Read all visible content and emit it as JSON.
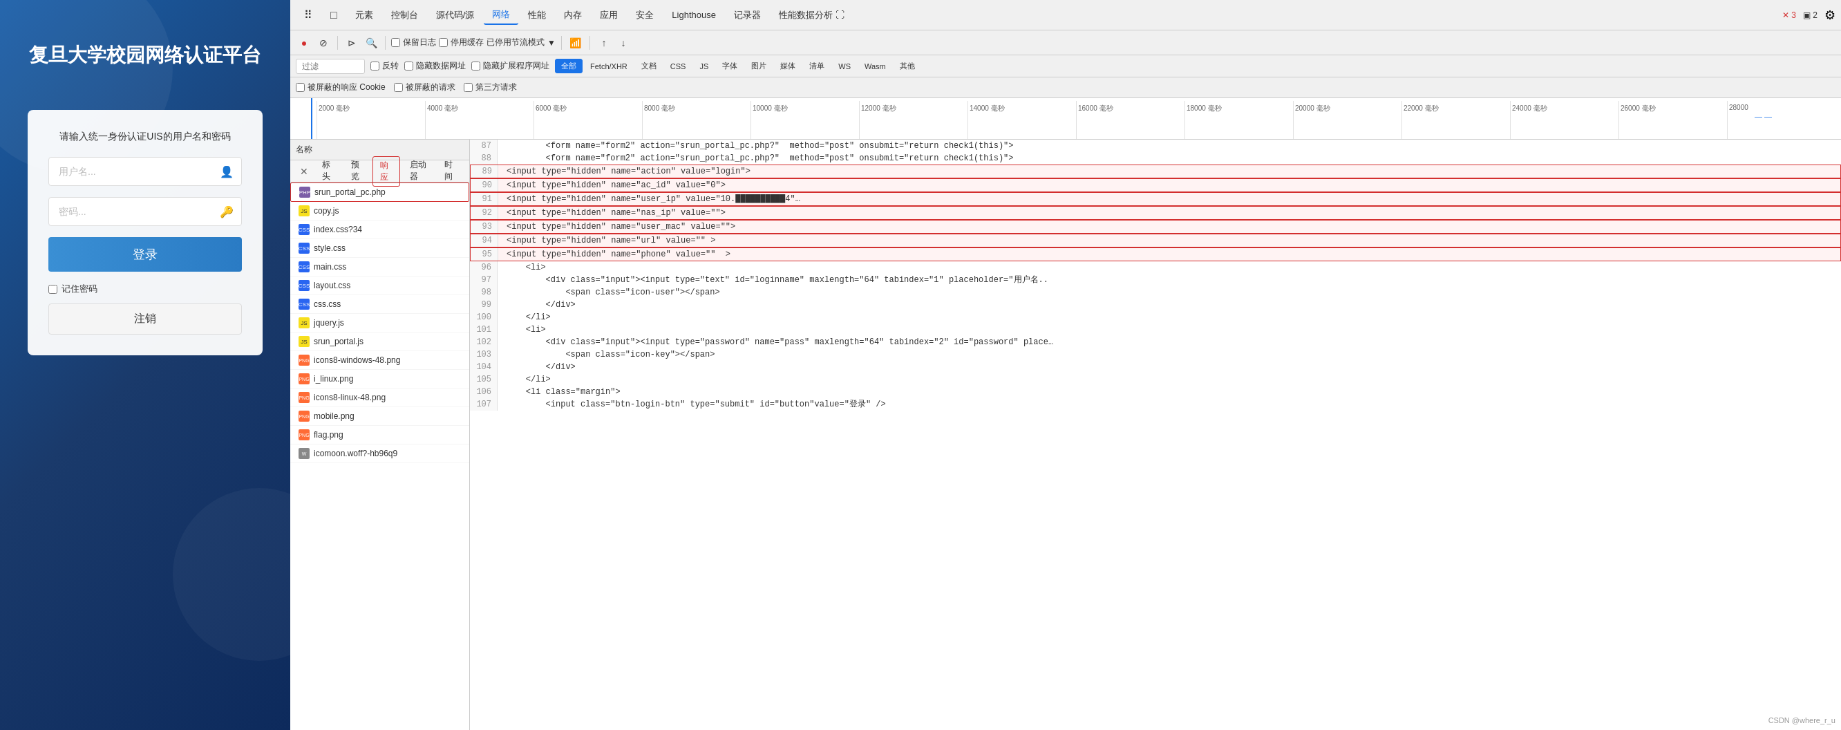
{
  "leftPanel": {
    "siteTitle": "复旦大学校园网络认证平台",
    "loginCard": {
      "subtitle": "请输入统一身份认证UIS的用户名和密码",
      "usernamePlaceholder": "用户名...",
      "passwordPlaceholder": "密码...",
      "loginButton": "登录",
      "rememberLabel": "记住密码",
      "cancelButton": "注销"
    }
  },
  "devtools": {
    "tabs": [
      {
        "label": "⠿",
        "id": "grid"
      },
      {
        "label": "□",
        "id": "cursor"
      },
      {
        "label": "元素",
        "id": "elements"
      },
      {
        "label": "控制台",
        "id": "console"
      },
      {
        "label": "源代码/源",
        "id": "sources"
      },
      {
        "label": "网络",
        "id": "network",
        "active": true
      },
      {
        "label": "性能",
        "id": "performance"
      },
      {
        "label": "内存",
        "id": "memory"
      },
      {
        "label": "应用",
        "id": "application"
      },
      {
        "label": "安全",
        "id": "security"
      },
      {
        "label": "Lighthouse",
        "id": "lighthouse"
      },
      {
        "label": "记录器",
        "id": "recorder"
      },
      {
        "label": "性能数据分析 ⛶",
        "id": "perf-insights"
      }
    ],
    "controls": {
      "recordBtn": "●",
      "stopBtn": "⊘",
      "filterBtn": "⊳",
      "searchBtn": "🔍",
      "preserveLog": "保留日志",
      "disableCache": "停用缓存",
      "throttleStatus": "已停用节流模式",
      "wifiBtn": "📶",
      "uploadBtn": "↑",
      "downloadBtn": "↓"
    },
    "filter": {
      "placeholder": "过滤",
      "invertLabel": "反转",
      "hideDataUrls": "隐藏数据网址",
      "hideExtUrls": "隐藏扩展程序网址",
      "types": [
        "全部",
        "Fetch/XHR",
        "文档",
        "CSS",
        "JS",
        "字体",
        "图片",
        "媒体",
        "清单",
        "WS",
        "Wasm",
        "其他"
      ],
      "activeType": "全部"
    },
    "filter2": {
      "blockedCookies": "被屏蔽的响应 Cookie",
      "blockedRequests": "被屏蔽的请求",
      "thirdParty": "第三方请求"
    },
    "timeline": {
      "ticks": [
        "2000 毫秒",
        "4000 毫秒",
        "6000 毫秒",
        "8000 毫秒",
        "10000 毫秒",
        "12000 毫秒",
        "14000 毫秒",
        "16000 毫秒",
        "18000 毫秒",
        "20000 毫秒",
        "22000 毫秒",
        "24000 毫秒",
        "26000 毫秒",
        "28000"
      ]
    },
    "fileList": {
      "headerName": "名称",
      "files": [
        {
          "name": "srun_portal_pc.php",
          "type": "php",
          "selected": true,
          "highlighted": true
        },
        {
          "name": "copy.js",
          "type": "js"
        },
        {
          "name": "index.css?34",
          "type": "css"
        },
        {
          "name": "style.css",
          "type": "css"
        },
        {
          "name": "main.css",
          "type": "css"
        },
        {
          "name": "layout.css",
          "type": "css"
        },
        {
          "name": "css.css",
          "type": "css"
        },
        {
          "name": "jquery.js",
          "type": "js"
        },
        {
          "name": "srun_portal.js",
          "type": "js"
        },
        {
          "name": "icons8-windows-48.png",
          "type": "png"
        },
        {
          "name": "i_linux.png",
          "type": "png"
        },
        {
          "name": "icons8-linux-48.png",
          "type": "png"
        },
        {
          "name": "mobile.png",
          "type": "png"
        },
        {
          "name": "flag.png",
          "type": "png"
        },
        {
          "name": "icomoon.woff?-hb96q9",
          "type": "woff"
        }
      ]
    },
    "responseTabs": {
      "closeBtn": "✕",
      "tabs": [
        {
          "label": "标头",
          "active": false
        },
        {
          "label": "预览",
          "active": false
        },
        {
          "label": "响应",
          "active": true
        },
        {
          "label": "启动器",
          "active": false
        },
        {
          "label": "时间",
          "active": false
        }
      ]
    },
    "codeLines": [
      {
        "num": 87,
        "code": "        <form name=\"form2\" action=\"srun_portal_pc.php?\"  method=\"post\" onsubmit=\"return check1(this)\">",
        "highlight": false
      },
      {
        "num": 88,
        "code": "        <form name=\"form2\" action=\"srun_portal_pc.php?\"  method=\"post\" onsubmit=\"return check1(this)\">",
        "highlight": false
      },
      {
        "num": 89,
        "code": "<input type=\"hidden\" name=\"action\" value=\"login\">",
        "highlight": true
      },
      {
        "num": 90,
        "code": "<input type=\"hidden\" name=\"ac_id\" value=\"0\">",
        "highlight": true
      },
      {
        "num": 91,
        "code": "<input type=\"hidden\" name=\"user_ip\" value=\"10.██████████4\"…",
        "highlight": true
      },
      {
        "num": 92,
        "code": "<input type=\"hidden\" name=\"nas_ip\" value=\"\">",
        "highlight": true
      },
      {
        "num": 93,
        "code": "<input type=\"hidden\" name=\"user_mac\" value=\"\">",
        "highlight": true
      },
      {
        "num": 94,
        "code": "<input type=\"hidden\" name=\"url\" value=\"\" >",
        "highlight": true
      },
      {
        "num": 95,
        "code": "<input type=\"hidden\" name=\"phone\" value=\"\"  >",
        "highlight": true
      },
      {
        "num": 96,
        "code": "    <li>",
        "highlight": false
      },
      {
        "num": 97,
        "code": "        <div class=\"input\"><input type=\"text\" id=\"loginname\" maxlength=\"64\" tabindex=\"1\" placeholder=\"用户名..",
        "highlight": false
      },
      {
        "num": 98,
        "code": "            <span class=\"icon-user\"></span>",
        "highlight": false
      },
      {
        "num": 99,
        "code": "        </div>",
        "highlight": false
      },
      {
        "num": 100,
        "code": "    </li>",
        "highlight": false
      },
      {
        "num": 101,
        "code": "    <li>",
        "highlight": false
      },
      {
        "num": 102,
        "code": "        <div class=\"input\"><input type=\"password\" name=\"pass\" maxlength=\"64\" tabindex=\"2\" id=\"password\" place…",
        "highlight": false
      },
      {
        "num": 103,
        "code": "            <span class=\"icon-key\"></span>",
        "highlight": false
      },
      {
        "num": 104,
        "code": "        </div>",
        "highlight": false
      },
      {
        "num": 105,
        "code": "    </li>",
        "highlight": false
      },
      {
        "num": 106,
        "code": "    <li class=\"margin\">",
        "highlight": false
      },
      {
        "num": 107,
        "code": "        <input class=\"btn-login-btn\" type=\"submit\" id=\"button\"value=\"登录\" />",
        "highlight": false
      }
    ]
  },
  "watermark": "CSDN @where_r_u"
}
